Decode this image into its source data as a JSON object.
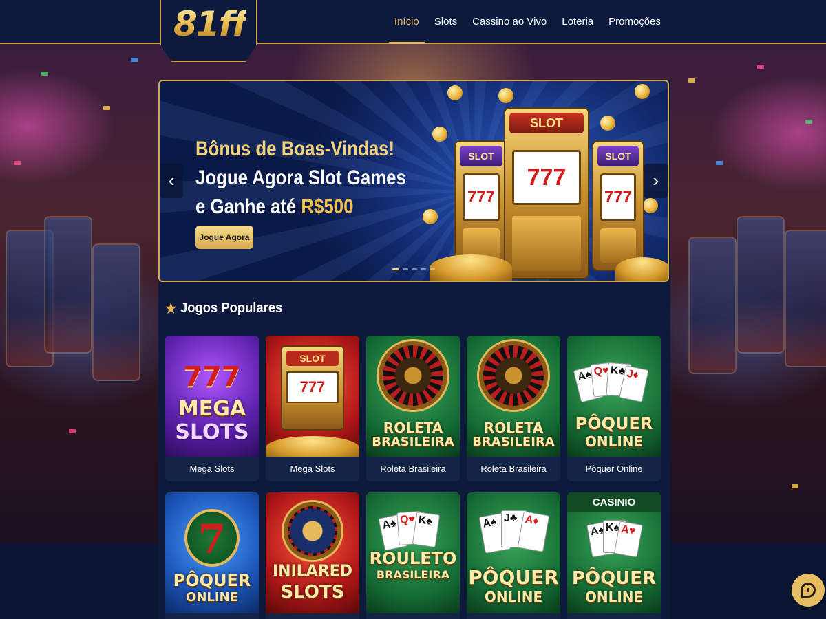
{
  "header": {
    "logo": "81ff",
    "nav": [
      {
        "label": "Início",
        "active": true
      },
      {
        "label": "Slots",
        "active": false
      },
      {
        "label": "Cassino ao Vivo",
        "active": false
      },
      {
        "label": "Loteria",
        "active": false
      },
      {
        "label": "Promoções",
        "active": false
      }
    ]
  },
  "banner": {
    "line1": "Bônus de Boas-Vindas!",
    "line2": "Jogue Agora Slot Games",
    "line3_prefix": "e Ganhe até ",
    "line3_amount": "R$500",
    "cta": "Jogue Agora",
    "machine_labels": [
      "SLOT",
      "SLOT",
      "SLOT"
    ],
    "reels": "777",
    "prev_icon": "chevron-left-icon",
    "next_icon": "chevron-right-icon"
  },
  "section": {
    "title": "Jogos Populares",
    "icon": "star-icon"
  },
  "games": [
    {
      "name": "Mega Slots",
      "art_text": [
        "777",
        "MEGA",
        "SLOTS"
      ]
    },
    {
      "name": "Mega Slots",
      "art_text": [
        "SLOT",
        "777"
      ]
    },
    {
      "name": "Roleta Brasileira",
      "art_text": [
        "ROLETA",
        "BRASILEIRA"
      ]
    },
    {
      "name": "Roleta Brasileira",
      "art_text": [
        "ROLETA",
        "BRASILEIRA"
      ]
    },
    {
      "name": "Pôquer Online",
      "art_text": [
        "PÔQUER",
        "ONLINE"
      ]
    },
    {
      "name": "",
      "art_text": [
        "7",
        "PÔQUER",
        "ONLINE"
      ]
    },
    {
      "name": "",
      "art_text": [
        "INILARED",
        "SLOTS"
      ]
    },
    {
      "name": "",
      "art_text": [
        "ROULETO",
        "BRASILEIRA"
      ]
    },
    {
      "name": "",
      "art_text": [
        "PÔQUER",
        "ONLINE"
      ]
    },
    {
      "name": "",
      "art_text": [
        "CASINIO",
        "PÔQUER",
        "ONLINE"
      ]
    }
  ],
  "chat": {
    "icon": "chat-icon"
  },
  "colors": {
    "accent_gold": "#e6b95a",
    "header_bg": "#0d1a3d",
    "page_bg": "#0c1633"
  }
}
